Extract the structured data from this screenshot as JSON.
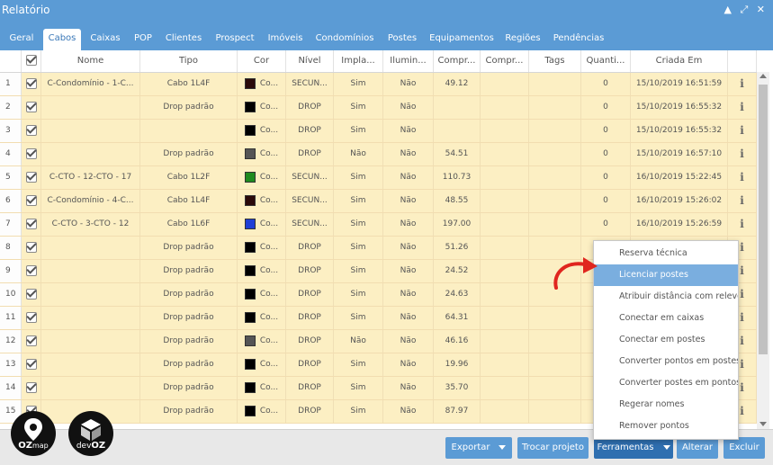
{
  "window": {
    "title": "Relatório",
    "controls": "▲ ⤢ ✕"
  },
  "tabs": [
    {
      "label": "Geral",
      "active": false
    },
    {
      "label": "Cabos",
      "active": true
    },
    {
      "label": "Caixas",
      "active": false
    },
    {
      "label": "POP",
      "active": false
    },
    {
      "label": "Clientes",
      "active": false
    },
    {
      "label": "Prospect",
      "active": false
    },
    {
      "label": "Imóveis",
      "active": false
    },
    {
      "label": "Condomínios",
      "active": false
    },
    {
      "label": "Postes",
      "active": false
    },
    {
      "label": "Equipamentos",
      "active": false
    },
    {
      "label": "Regiões",
      "active": false
    },
    {
      "label": "Pendências",
      "active": false
    }
  ],
  "columns": [
    "",
    "Nome",
    "Tipo",
    "Cor",
    "Nível",
    "Impla...",
    "Ilumin...",
    "Compr...",
    "Compr...",
    "Tags",
    "Quanti...",
    "Criada Em",
    ""
  ],
  "rows": [
    {
      "num": "1",
      "nome": "C-Condomínio - 1-C...",
      "tipo": "Cabo 1L4F",
      "color": "#2a0a0a",
      "cor": "Co...",
      "nivel": "SECUN...",
      "impl": "Sim",
      "ilum": "Não",
      "comp1": "49.12",
      "comp2": "",
      "tags": "",
      "qtd": "0",
      "criada": "15/10/2019 16:51:59"
    },
    {
      "num": "2",
      "nome": "",
      "tipo": "Drop padrão",
      "color": "#000000",
      "cor": "Co...",
      "nivel": "DROP",
      "impl": "Sim",
      "ilum": "Não",
      "comp1": "",
      "comp2": "",
      "tags": "",
      "qtd": "0",
      "criada": "15/10/2019 16:55:32"
    },
    {
      "num": "3",
      "nome": "",
      "tipo": "",
      "color": "#000000",
      "cor": "Co...",
      "nivel": "DROP",
      "impl": "Sim",
      "ilum": "Não",
      "comp1": "",
      "comp2": "",
      "tags": "",
      "qtd": "0",
      "criada": "15/10/2019 16:55:32"
    },
    {
      "num": "4",
      "nome": "",
      "tipo": "Drop padrão",
      "color": "#555555",
      "cor": "Co...",
      "nivel": "DROP",
      "impl": "Não",
      "ilum": "Não",
      "comp1": "54.51",
      "comp2": "",
      "tags": "",
      "qtd": "0",
      "criada": "15/10/2019 16:57:10"
    },
    {
      "num": "5",
      "nome": "C-CTO - 12-CTO - 17",
      "tipo": "Cabo 1L2F",
      "color": "#1f8a1f",
      "cor": "Co...",
      "nivel": "SECUN...",
      "impl": "Sim",
      "ilum": "Não",
      "comp1": "110.73",
      "comp2": "",
      "tags": "",
      "qtd": "0",
      "criada": "16/10/2019 15:22:45"
    },
    {
      "num": "6",
      "nome": "C-Condomínio - 4-C...",
      "tipo": "Cabo 1L4F",
      "color": "#2a0a0a",
      "cor": "Co...",
      "nivel": "SECUN...",
      "impl": "Sim",
      "ilum": "Não",
      "comp1": "48.55",
      "comp2": "",
      "tags": "",
      "qtd": "0",
      "criada": "16/10/2019 15:26:02"
    },
    {
      "num": "7",
      "nome": "C-CTO - 3-CTO - 12",
      "tipo": "Cabo 1L6F",
      "color": "#1f3fd6",
      "cor": "Co...",
      "nivel": "SECUN...",
      "impl": "Sim",
      "ilum": "Não",
      "comp1": "197.00",
      "comp2": "",
      "tags": "",
      "qtd": "0",
      "criada": "16/10/2019 15:26:59"
    },
    {
      "num": "8",
      "nome": "",
      "tipo": "Drop padrão",
      "color": "#000000",
      "cor": "Co...",
      "nivel": "DROP",
      "impl": "Sim",
      "ilum": "Não",
      "comp1": "51.26",
      "comp2": "",
      "tags": "",
      "qtd": "",
      "criada": ""
    },
    {
      "num": "9",
      "nome": "",
      "tipo": "Drop padrão",
      "color": "#000000",
      "cor": "Co...",
      "nivel": "DROP",
      "impl": "Sim",
      "ilum": "Não",
      "comp1": "24.52",
      "comp2": "",
      "tags": "",
      "qtd": "",
      "criada": ""
    },
    {
      "num": "10",
      "nome": "",
      "tipo": "Drop padrão",
      "color": "#000000",
      "cor": "Co...",
      "nivel": "DROP",
      "impl": "Sim",
      "ilum": "Não",
      "comp1": "24.63",
      "comp2": "",
      "tags": "",
      "qtd": "",
      "criada": ""
    },
    {
      "num": "11",
      "nome": "",
      "tipo": "Drop padrão",
      "color": "#000000",
      "cor": "Co...",
      "nivel": "DROP",
      "impl": "Sim",
      "ilum": "Não",
      "comp1": "64.31",
      "comp2": "",
      "tags": "",
      "qtd": "",
      "criada": ""
    },
    {
      "num": "12",
      "nome": "",
      "tipo": "Drop padrão",
      "color": "#555555",
      "cor": "Co...",
      "nivel": "DROP",
      "impl": "Não",
      "ilum": "Não",
      "comp1": "46.16",
      "comp2": "",
      "tags": "",
      "qtd": "",
      "criada": ""
    },
    {
      "num": "13",
      "nome": "",
      "tipo": "Drop padrão",
      "color": "#000000",
      "cor": "Co...",
      "nivel": "DROP",
      "impl": "Sim",
      "ilum": "Não",
      "comp1": "19.96",
      "comp2": "",
      "tags": "",
      "qtd": "",
      "criada": ""
    },
    {
      "num": "14",
      "nome": "",
      "tipo": "Drop padrão",
      "color": "#000000",
      "cor": "Co...",
      "nivel": "DROP",
      "impl": "Sim",
      "ilum": "Não",
      "comp1": "35.70",
      "comp2": "",
      "tags": "",
      "qtd": "",
      "criada": ""
    },
    {
      "num": "15",
      "nome": "",
      "tipo": "Drop padrão",
      "color": "#000000",
      "cor": "Co...",
      "nivel": "DROP",
      "impl": "Sim",
      "ilum": "Não",
      "comp1": "87.97",
      "comp2": "",
      "tags": "",
      "qtd": "",
      "criada": ""
    }
  ],
  "menu": [
    {
      "label": "Reserva técnica",
      "highlighted": false
    },
    {
      "label": "Licenciar postes",
      "highlighted": true
    },
    {
      "label": "Atribuir distância com relevo",
      "highlighted": false
    },
    {
      "label": "Conectar em caixas",
      "highlighted": false
    },
    {
      "label": "Conectar em postes",
      "highlighted": false
    },
    {
      "label": "Converter pontos em postes",
      "highlighted": false
    },
    {
      "label": "Converter postes em pontos",
      "highlighted": false
    },
    {
      "label": "Regerar nomes",
      "highlighted": false
    },
    {
      "label": "Remover pontos",
      "highlighted": false
    }
  ],
  "buttons": {
    "exportar": "Exportar",
    "trocar": "Trocar projeto",
    "ferramentas": "Ferramentas",
    "alterar": "Alterar",
    "excluir": "Excluir"
  },
  "logos": {
    "ozmap_prefix": "OZ",
    "ozmap_suffix": "map",
    "devoz_prefix": "dev",
    "devoz_suffix": "OZ"
  },
  "colors": {
    "accent": "#5b9bd5",
    "row_bg": "#fcefc3",
    "menu_highlight": "#7aaedf",
    "arrow": "#e0261f"
  }
}
